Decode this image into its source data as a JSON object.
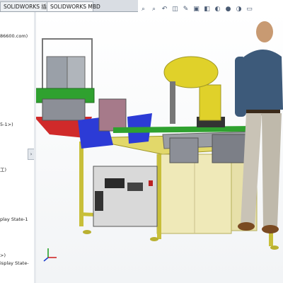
{
  "tabs": [
    {
      "label": "SOLIDWORKS 插件"
    },
    {
      "label": "SOLIDWORKS MBD"
    }
  ],
  "feature_tree": {
    "lines": [
      {
        "text": "86600.com)"
      },
      {
        "text": "5-1>)"
      },
      {
        "text": "工)"
      },
      {
        "text": "play State-1"
      },
      {
        "text": ">)"
      },
      {
        "text": "isplay State-"
      }
    ],
    "collapse_glyph": "›"
  },
  "hud_icons": [
    "zoom-to-fit-icon",
    "zoom-area-icon",
    "previous-view-icon",
    "section-view-icon",
    "dynamic-annotation-icon",
    "view-orientation-icon",
    "display-style-icon",
    "hide-show-icon",
    "edit-appearance-icon",
    "apply-scene-icon",
    "view-settings-icon"
  ],
  "colors": {
    "frame": "#c8bf3a",
    "frame_dark": "#9f9725",
    "cabinet_beige": "#efe9b8",
    "robot_yellow": "#e0d12a",
    "blue_part": "#2c3bd6",
    "red_part": "#d02a2a",
    "green_rail": "#2fa12f",
    "grey_part": "#8c8f97",
    "control_box": "#d9d9d9"
  }
}
